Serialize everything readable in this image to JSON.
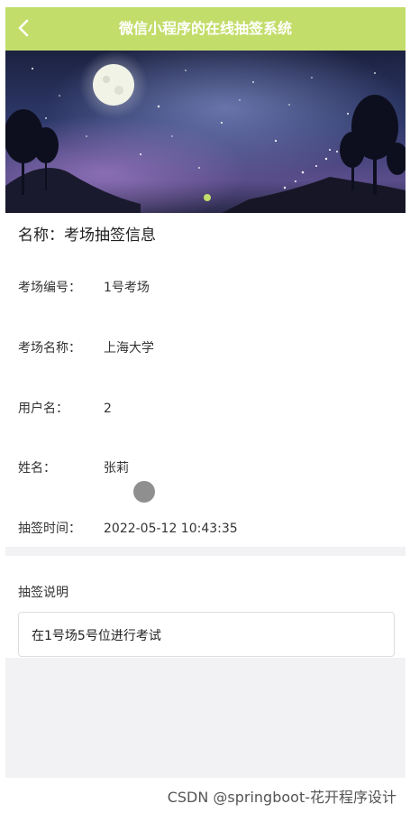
{
  "navbar": {
    "title": "微信小程序的在线抽签系统",
    "back_icon": "chevron-left-icon",
    "background": "#c3dd6b"
  },
  "banner": {
    "image": "night-sky-moon-stars",
    "active_dot_color": "#c3dd6b"
  },
  "detail": {
    "name_label": "名称：",
    "name_value": "考场抽签信息",
    "fields": [
      {
        "label": "考场编号：",
        "value": "1号考场"
      },
      {
        "label": "考场名称：",
        "value": "上海大学"
      },
      {
        "label": "用户名：",
        "value": "2"
      },
      {
        "label": "姓名：",
        "value": "张莉"
      },
      {
        "label": "抽签时间：",
        "value": "2022-05-12 10:43:35"
      }
    ]
  },
  "description": {
    "label": "抽签说明",
    "value": "在1号场5号位进行考试"
  },
  "watermark": "CSDN @springboot-花开程序设计"
}
